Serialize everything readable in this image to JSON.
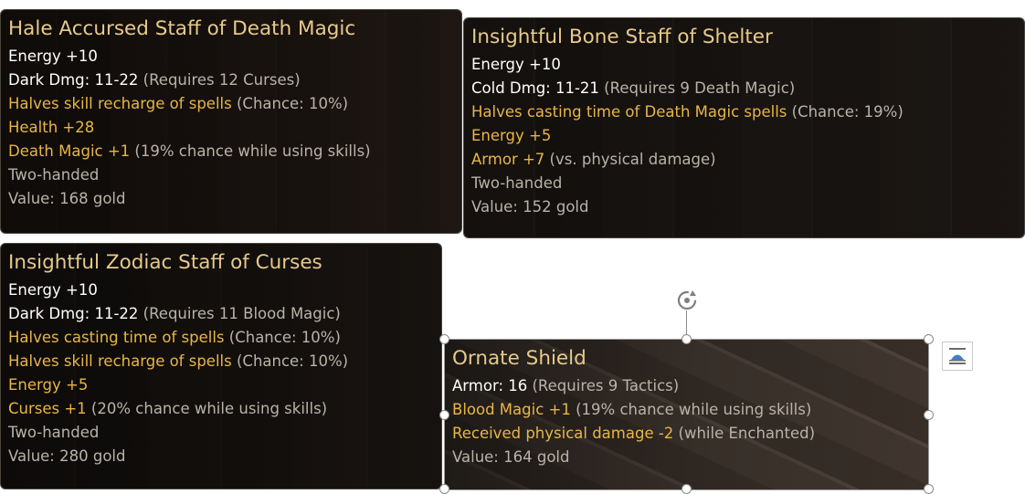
{
  "tooltips": [
    {
      "title": "Hale Accursed Staff of Death Magic",
      "lines": [
        {
          "text": "Energy +10",
          "color": "#ffffff"
        },
        {
          "text": "Dark Dmg: 11-22",
          "note": " (Requires 12 Curses)",
          "color": "#ffffff"
        },
        {
          "text": "Halves skill recharge of spells",
          "note": " (Chance: 10%)",
          "color": "#e8b646"
        },
        {
          "text": "Health +28",
          "color": "#e8b646"
        },
        {
          "text": "Death Magic +1",
          "note": " (19% chance while using skills)",
          "color": "#e8b646"
        },
        {
          "text": "Two-handed",
          "color": "#b9b3a7"
        },
        {
          "text": "Value: 168 gold",
          "color": "#b9b3a7"
        }
      ]
    },
    {
      "title": "Insightful Bone Staff of Shelter",
      "lines": [
        {
          "text": "Energy +10",
          "color": "#ffffff"
        },
        {
          "text": "Cold Dmg: 11-21",
          "note": " (Requires 9 Death Magic)",
          "color": "#ffffff"
        },
        {
          "text": "Halves casting time of Death Magic spells",
          "note": " (Chance: 19%)",
          "color": "#e8b646"
        },
        {
          "text": "Energy +5",
          "color": "#e8b646"
        },
        {
          "text": "Armor +7",
          "note": " (vs. physical damage)",
          "color": "#e8b646"
        },
        {
          "text": "Two-handed",
          "color": "#b9b3a7"
        },
        {
          "text": "Value: 152 gold",
          "color": "#b9b3a7"
        }
      ]
    },
    {
      "title": "Insightful Zodiac Staff of Curses",
      "lines": [
        {
          "text": "Energy +10",
          "color": "#ffffff"
        },
        {
          "text": "Dark Dmg: 11-22",
          "note": " (Requires 11 Blood Magic)",
          "color": "#ffffff"
        },
        {
          "text": "Halves casting time of spells",
          "note": " (Chance: 10%)",
          "color": "#e8b646"
        },
        {
          "text": "Halves skill recharge of spells",
          "note": " (Chance: 10%)",
          "color": "#e8b646"
        },
        {
          "text": "Energy +5",
          "color": "#e8b646"
        },
        {
          "text": "Curses +1",
          "note": " (20% chance while using skills)",
          "color": "#e8b646"
        },
        {
          "text": "Two-handed",
          "color": "#b9b3a7"
        },
        {
          "text": "Value: 280 gold",
          "color": "#b9b3a7"
        }
      ]
    },
    {
      "title": "Ornate Shield",
      "lines": [
        {
          "text": "Armor: 16",
          "note": " (Requires 9 Tactics)",
          "color": "#ffffff"
        },
        {
          "text": "Blood Magic +1",
          "note": " (19% chance while using skills)",
          "color": "#e8b646"
        },
        {
          "text": "Received physical damage -2",
          "note": " (while Enchanted)",
          "color": "#e8b646"
        },
        {
          "text": "Value: 164 gold",
          "color": "#b9b3a7"
        }
      ]
    }
  ],
  "colors": {
    "title": "#e7c98a",
    "stat_white": "#ffffff",
    "bonus_gold": "#e8b646",
    "note_gray": "#b9b3a7"
  },
  "icons": {
    "rotate": "rotate-handle-icon",
    "layout": "layout-options-icon"
  }
}
